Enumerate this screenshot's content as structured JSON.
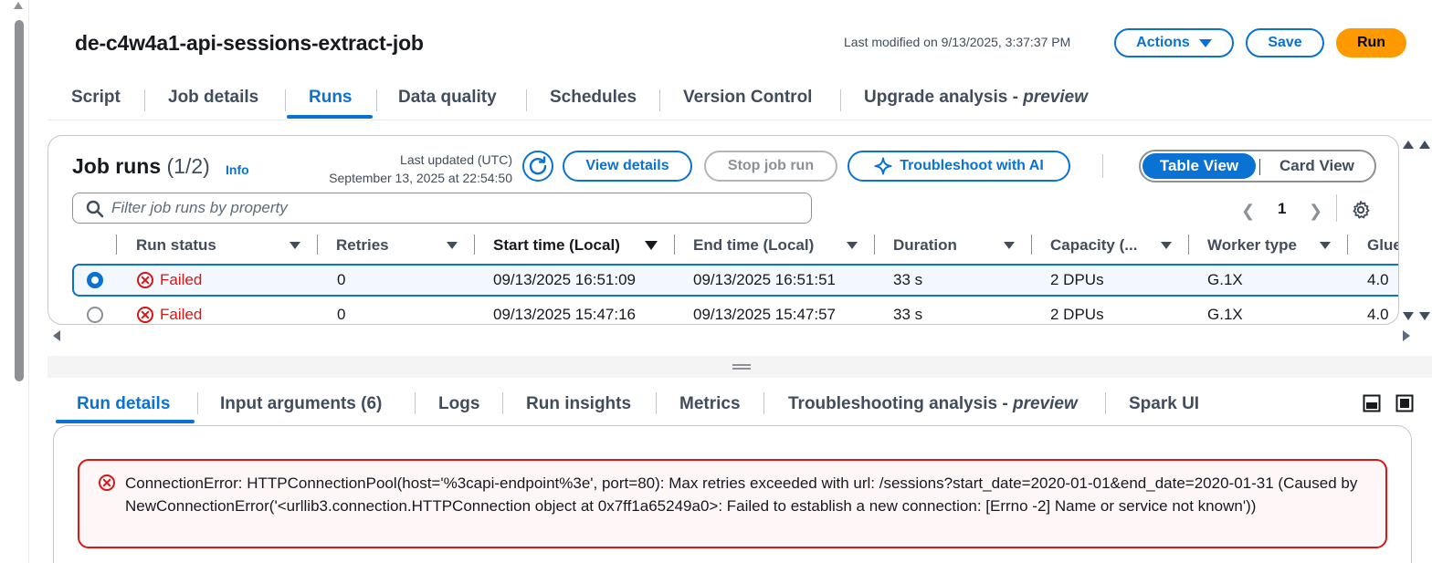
{
  "job": {
    "title": "de-c4w4a1-api-sessions-extract-job",
    "last_modified": "Last modified on 9/13/2025, 3:37:37 PM"
  },
  "header_buttons": {
    "actions": "Actions",
    "save": "Save",
    "run": "Run"
  },
  "top_tabs": [
    "Script",
    "Job details",
    "Runs",
    "Data quality",
    "Schedules",
    "Version Control",
    "Upgrade analysis - "
  ],
  "top_tab_suffix": "preview",
  "job_runs": {
    "title": "Job runs",
    "count": "(1/2)",
    "info": "Info",
    "last_updated_label": "Last updated (UTC)",
    "last_updated_value": "September 13, 2025 at 22:54:50",
    "view_details": "View details",
    "stop_job_run": "Stop job run",
    "troubleshoot": "Troubleshoot with AI",
    "table_view": "Table View",
    "card_view": "Card View",
    "filter_placeholder": "Filter job runs by property",
    "page": "1"
  },
  "table": {
    "columns": [
      "Run status",
      "Retries",
      "Start time (Local)",
      "End time (Local)",
      "Duration",
      "Capacity (...",
      "Worker type",
      "Glue"
    ],
    "rows": [
      {
        "status": "Failed",
        "retries": "0",
        "start": "09/13/2025 16:51:09",
        "end": "09/13/2025 16:51:51",
        "duration": "33 s",
        "capacity": "2 DPUs",
        "worker": "G.1X",
        "glue": "4.0",
        "selected": true
      },
      {
        "status": "Failed",
        "retries": "0",
        "start": "09/13/2025 15:47:16",
        "end": "09/13/2025 15:47:57",
        "duration": "33 s",
        "capacity": "2 DPUs",
        "worker": "G.1X",
        "glue": "4.0",
        "selected": false
      }
    ]
  },
  "bottom_tabs": [
    "Run details",
    "Input arguments (6)",
    "Logs",
    "Run insights",
    "Metrics",
    "Troubleshooting analysis - ",
    "Spark UI"
  ],
  "bottom_tab_suffix": "preview",
  "error": {
    "message": "ConnectionError: HTTPConnectionPool(host='%3capi-endpoint%3e', port=80): Max retries exceeded with url: /sessions?start_date=2020-01-01&end_date=2020-01-31 (Caused by NewConnectionError('<urllib3.connection.HTTPConnection object at 0x7ff1a65249a0>: Failed to establish a new connection: [Errno -2] Name or service not known'))"
  },
  "colors": {
    "accent": "#0972d3",
    "run_button": "#ff9900",
    "error": "#d91515"
  }
}
